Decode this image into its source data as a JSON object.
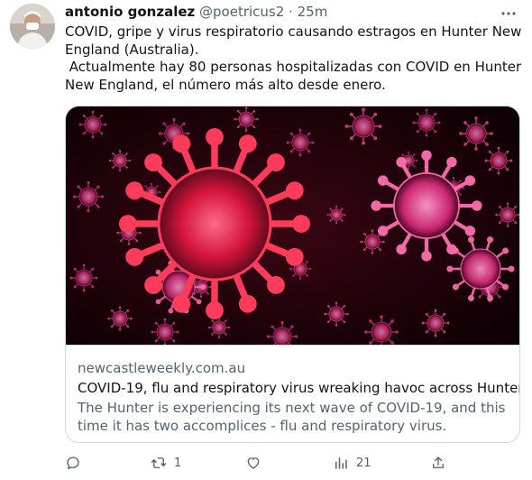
{
  "tweet": {
    "author_name": "antonio gonzalez",
    "author_handle": "@poetricus2",
    "separator": "·",
    "time": "25m",
    "text_line1": "COVID, gripe y virus respiratorio causando estragos en Hunter New England (Australia).",
    "text_line2": " Actualmente hay 80 personas hospitalizadas con COVID en Hunter New England, el número más alto desde enero."
  },
  "card": {
    "domain": "newcastleweekly.com.au",
    "title": "COVID-19, flu and respiratory virus wreaking havoc across Hunter",
    "description": "The Hunter is experiencing its next wave of COVID-19, and this time it has two accomplices - flu and respiratory virus."
  },
  "actions": {
    "reply_count": "",
    "retweet_count": "1",
    "like_count": "",
    "views_count": "21"
  },
  "colors": {
    "text": "#0f1419",
    "secondary": "#536471",
    "border": "#cfd9de",
    "virus_red": "#d4143a",
    "virus_pink": "#ff4f9a"
  },
  "icons": [
    "more-icon",
    "reply-icon",
    "retweet-icon",
    "like-icon",
    "views-icon",
    "share-icon"
  ]
}
